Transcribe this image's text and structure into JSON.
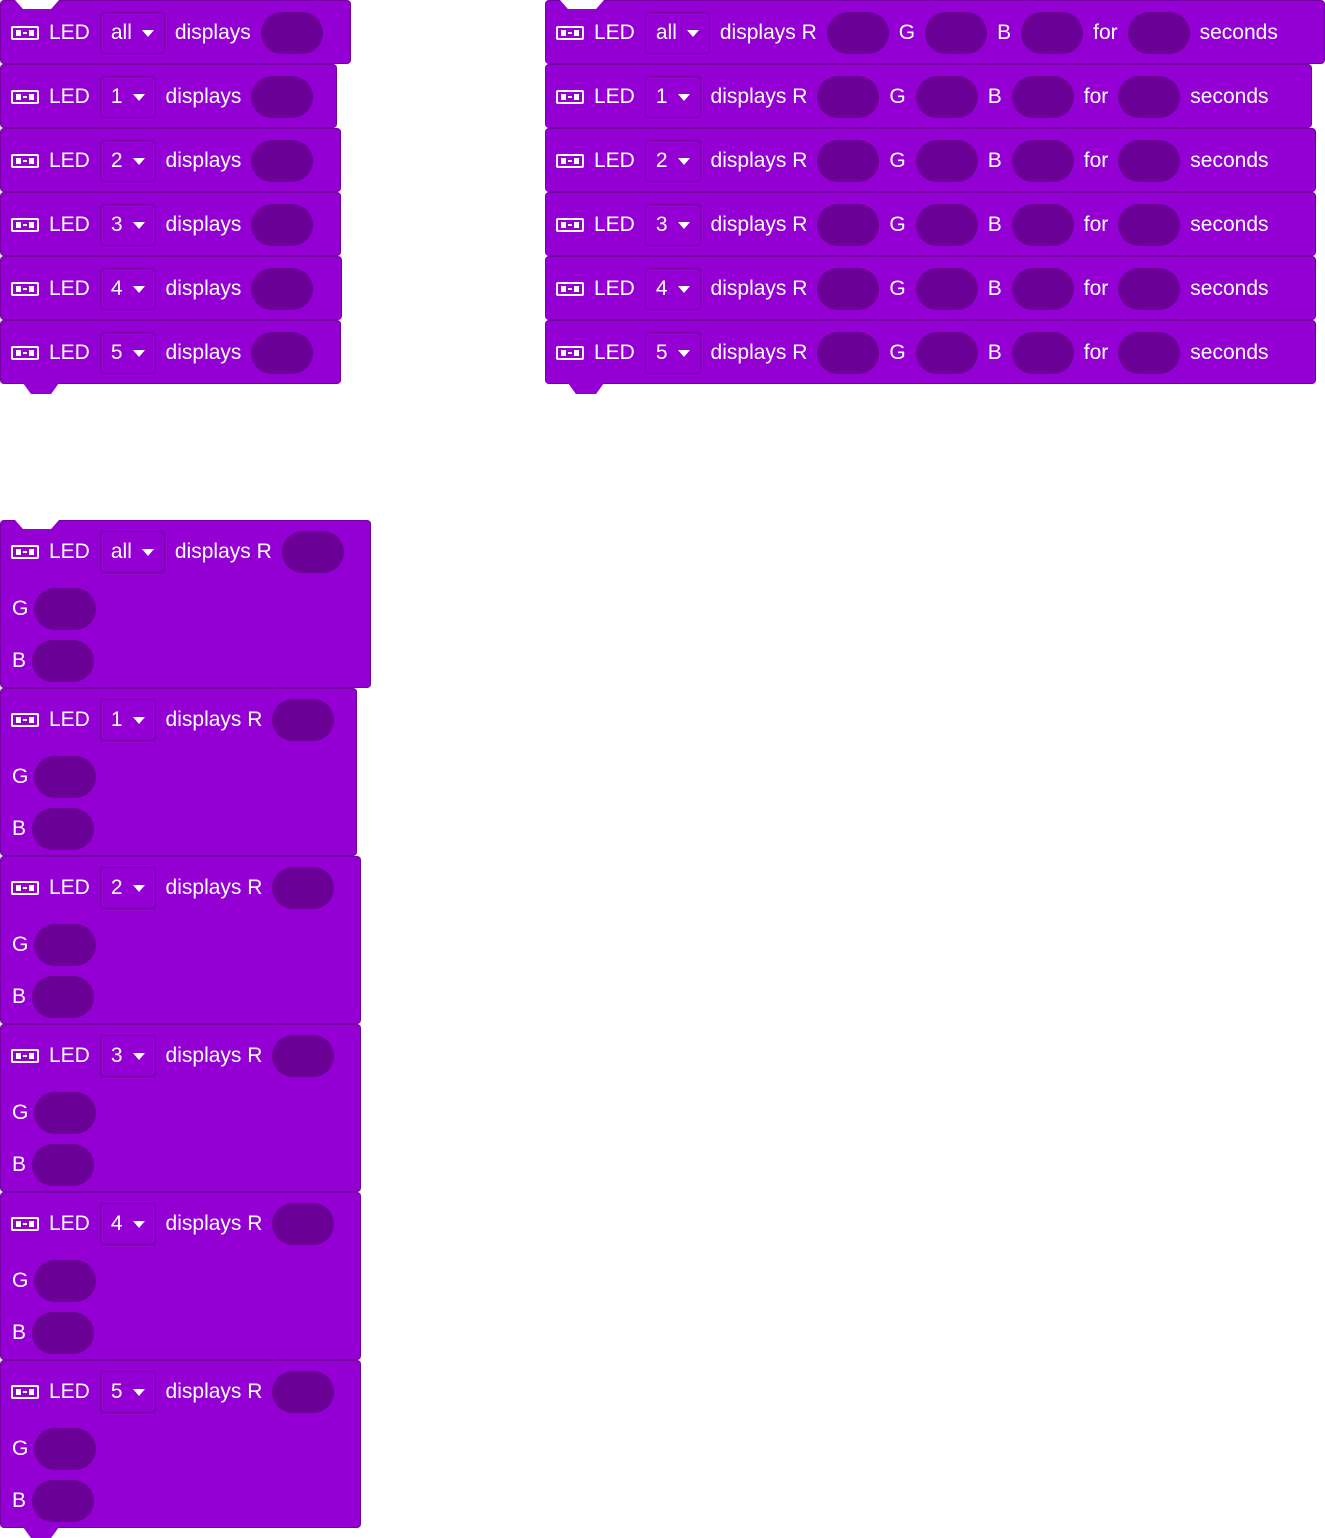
{
  "labels": {
    "led": "LED",
    "displays": "displays",
    "displays_r": "displays R",
    "g": "G",
    "b": "B",
    "for": "for",
    "seconds": "seconds"
  },
  "icons": {
    "led": "led-strip-icon",
    "dropdown": "caret-down-icon"
  },
  "colors": {
    "block": "#9400d3",
    "block_border": "#7400a6",
    "slot": "#6a0096",
    "text": "#ffffff"
  },
  "options": [
    "all",
    "1",
    "2",
    "3",
    "4",
    "5"
  ],
  "stacks": {
    "simple": {
      "blocks": [
        "all",
        "1",
        "2",
        "3",
        "4",
        "5"
      ]
    },
    "rgb_timed": {
      "blocks": [
        "all",
        "1",
        "2",
        "3",
        "4",
        "5"
      ]
    },
    "rgb_multiline": {
      "blocks": [
        "all",
        "1",
        "2",
        "3",
        "4",
        "5"
      ]
    }
  }
}
